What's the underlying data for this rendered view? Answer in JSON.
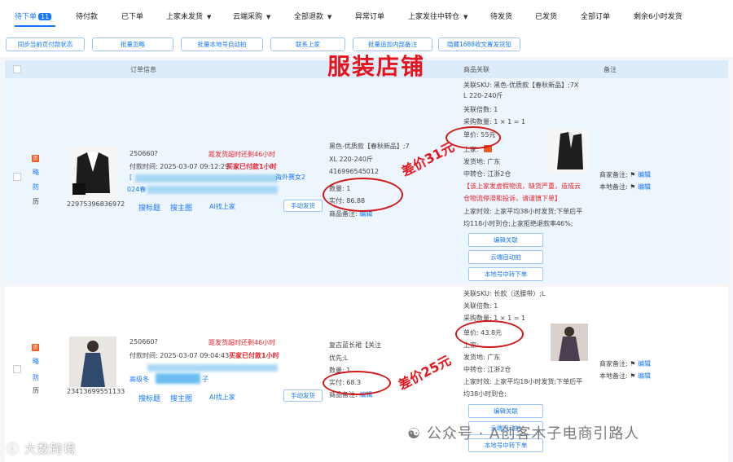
{
  "tabs": [
    {
      "label": "待下单",
      "badge": "11",
      "active": true
    },
    {
      "label": "待付款"
    },
    {
      "label": "已下单"
    },
    {
      "label": "上家未发货",
      "dropdown": true
    },
    {
      "label": "云端采购",
      "dropdown": true
    },
    {
      "label": "全部退款",
      "dropdown": true
    },
    {
      "label": "异常订单"
    },
    {
      "label": "上家发往中转仓",
      "dropdown": true
    },
    {
      "label": "待发货"
    },
    {
      "label": "已发货"
    },
    {
      "label": "全部订单"
    },
    {
      "label": "剩余6小时发货"
    }
  ],
  "toolbar": [
    "同步当前页付款状态",
    "批量忽略",
    "批量本地号自动拍",
    "联系上家",
    "批量追加内部备注",
    "隐藏1688收文置发货铅"
  ],
  "table_header": {
    "order_info": "订单信息",
    "product_link": "商品关联",
    "remark": "备注"
  },
  "overlay_title": "服装店铺",
  "rows": [
    {
      "tags": [
        "团",
        "略",
        "防",
        "历"
      ],
      "product_id": "22975396836972",
      "order_no": "250660?",
      "ship_warn": "距发货超时还剩46小时",
      "pay_time": "付款时间: 2025-03-07 09:12:29",
      "paid_note": "买家已付款1小时",
      "extra": "[",
      "extra2": "024春",
      "extra3": "海外赛女2",
      "actions": [
        "搜标题",
        "搜主图",
        "AI找上家"
      ],
      "manual_ship": "手动发货",
      "spec": "黑色-优质款【春秋新品】;7",
      "spec2": "XL 220-240斤",
      "sku_id": "416996545012",
      "qty": "数量: 1",
      "paid": "实付: 86.88",
      "internal_note": "商品备注: ",
      "internal_edit": "编辑",
      "link_sku": "关联SKU: 黑色-优质款【春秋新品】;7X",
      "link_sku2": "L 220-240斤",
      "link_multiple": "关联倍数: 1",
      "purchase_qty": "采购数量: 1 × 1 = 1",
      "unit_price": "单价: 55元",
      "supplier": "上家: ",
      "ship_from": "发货地: 广东",
      "transit": "中转仓: 江浙2仓",
      "warn1": "【该上家发虚假物流，缺货严重，造成云",
      "warn2": "仓物流停滞和投诉，请谨慎下单】",
      "eff1": "上家时效: 上家平均38小时发货;下单后平",
      "eff2": "均118小时到仓;上家拒绝退款率46%;",
      "btns": [
        "编辑关联",
        "云端自动拍",
        "本地号中转下单"
      ],
      "merchant_remark": "商家备注: ",
      "local_remark": "本地备注: ",
      "edit": "编辑",
      "annot": "差价31元"
    },
    {
      "tags": [
        "团",
        "略",
        "防",
        "历"
      ],
      "product_id": "23413699551133",
      "order_no": "250660?",
      "ship_warn": "距发货超时还剩46小时",
      "pay_time": "付款时间: 2025-03-07 09:04:43",
      "paid_note": "买家已付款1小时",
      "extra": "高级冬",
      "extra2": "子",
      "actions": [
        "搜标题",
        "搜主图",
        "AI找上家"
      ],
      "manual_ship": "手动发货",
      "spec": "复古蓝长裙【关注",
      "spec2": "优先;L",
      "qty": "数量: 1",
      "paid": "实付: 68.3",
      "internal_note": "商品备注: ",
      "internal_edit": "编辑",
      "link_sku": "关联SKU: 长款（送腰带）;L",
      "link_multiple": "关联倍数: 1",
      "purchase_qty": "采购数量: 1 × 1 = 1",
      "unit_price": "单价: 43.8元",
      "supplier": "上家: ",
      "ship_from": "发货地: 广东",
      "transit": "中转仓: 江浙2仓",
      "eff1": "上家时效: 上家平均18小时发货;下单后平",
      "eff2": "均38小时到仓;",
      "btns": [
        "编辑关联",
        "云端自动拍",
        "本地号中转下单"
      ],
      "merchant_remark": "商家备注: ",
      "local_remark": "本地备注: ",
      "edit": "编辑",
      "annot": "差价25元"
    }
  ],
  "watermark_left": "大数跨境",
  "watermark_right": "公众号 · A创客木子电商引路人",
  "colors": {
    "accent": "#1677ff",
    "warn": "#e8222b",
    "annot": "#d01818",
    "row_bg": "#edf5fd",
    "header_bg": "#dcecfb"
  }
}
